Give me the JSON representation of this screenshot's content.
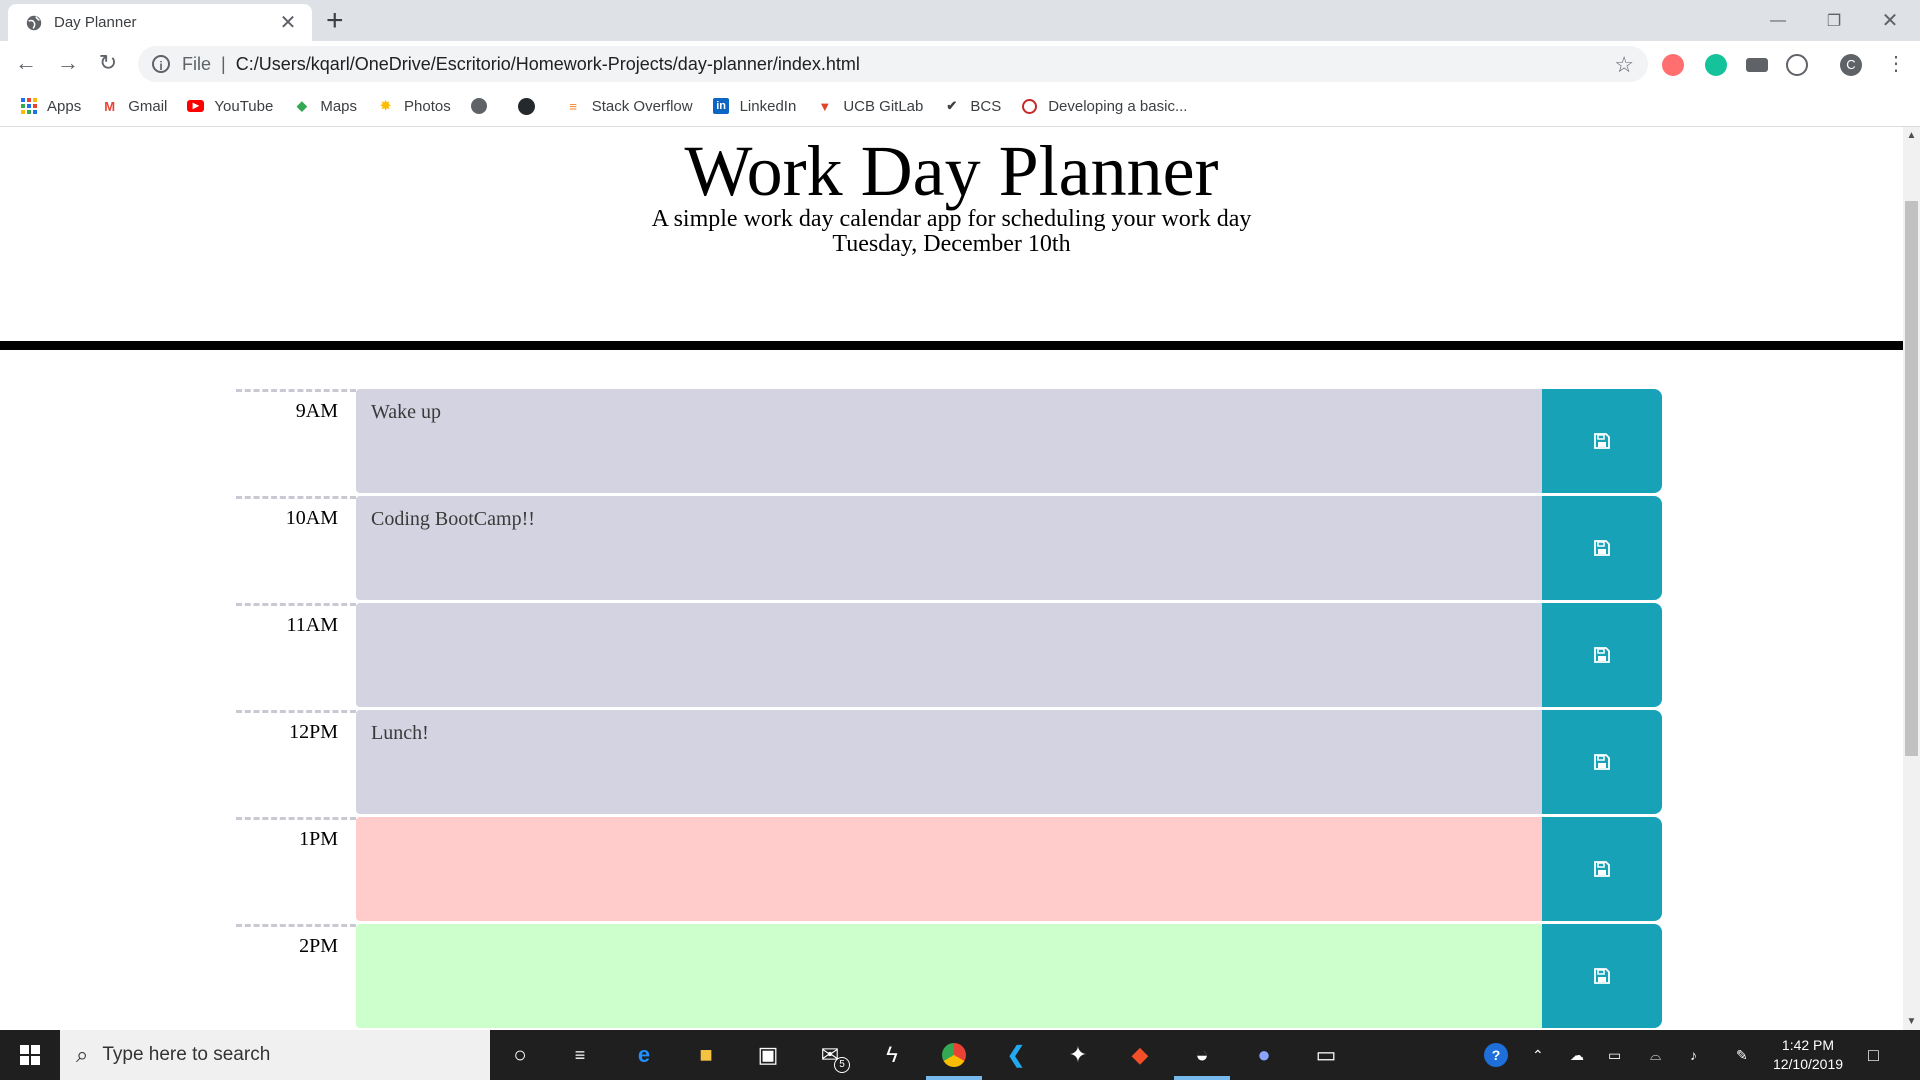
{
  "browser": {
    "tab_title": "Day Planner",
    "tab_close": "✕",
    "new_tab": "+",
    "url_scheme": "File",
    "url_path": "C:/Users/kqarl/OneDrive/Escritorio/Homework-Projects/day-planner/index.html",
    "profile_initial": "C",
    "bookmarks": [
      {
        "label": "Apps",
        "icon": "apps-grid-icon"
      },
      {
        "label": "Gmail",
        "icon": "gmail-icon"
      },
      {
        "label": "YouTube",
        "icon": "youtube-icon"
      },
      {
        "label": "Maps",
        "icon": "maps-icon"
      },
      {
        "label": "Photos",
        "icon": "photos-icon"
      },
      {
        "label": "",
        "icon": "globe-icon"
      },
      {
        "label": "",
        "icon": "github-icon"
      },
      {
        "label": "Stack Overflow",
        "icon": "stackoverflow-icon"
      },
      {
        "label": "LinkedIn",
        "icon": "linkedin-icon"
      },
      {
        "label": "UCB GitLab",
        "icon": "gitlab-icon"
      },
      {
        "label": "BCS",
        "icon": "bcs-icon"
      },
      {
        "label": "Developing a basic...",
        "icon": "page-icon"
      }
    ]
  },
  "page": {
    "title": "Work Day Planner",
    "lead": "A simple work day calendar app for scheduling your work day",
    "current_day": "Tuesday, December 10th"
  },
  "time_blocks": [
    {
      "hour": "9AM",
      "text": "Wake up",
      "state": "past"
    },
    {
      "hour": "10AM",
      "text": "Coding BootCamp!!",
      "state": "past"
    },
    {
      "hour": "11AM",
      "text": "",
      "state": "past"
    },
    {
      "hour": "12PM",
      "text": "Lunch!",
      "state": "past"
    },
    {
      "hour": "1PM",
      "text": "",
      "state": "present"
    },
    {
      "hour": "2PM",
      "text": "",
      "state": "future"
    }
  ],
  "colors": {
    "past": "#d3d3e1",
    "present": "#ffcccb",
    "future": "#ccffcb",
    "save_button": "#17a2b8"
  },
  "taskbar": {
    "search_placeholder": "Type here to search",
    "mail_badge": "5",
    "time": "1:42 PM",
    "date": "12/10/2019"
  }
}
